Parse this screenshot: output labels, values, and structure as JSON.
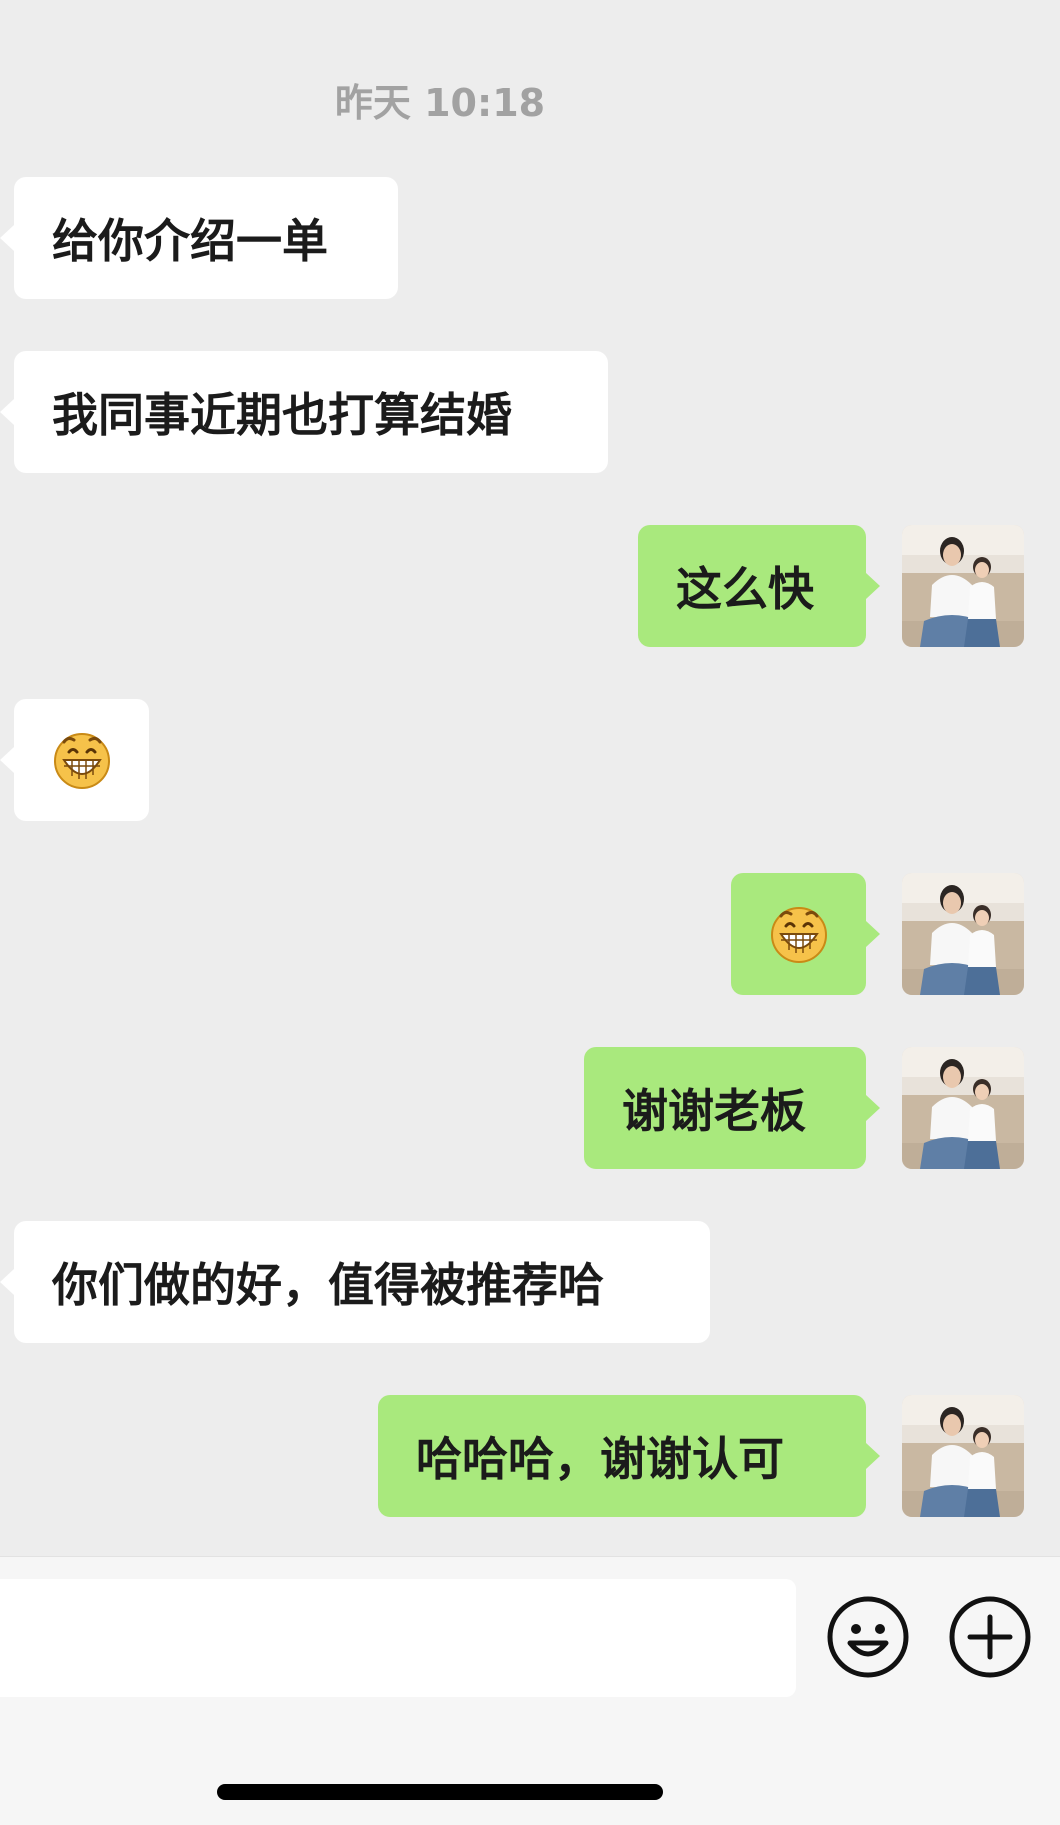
{
  "chat": {
    "timestamp": "昨天 10:18",
    "messages": [
      {
        "side": "in",
        "text": "给你介绍一单"
      },
      {
        "side": "in",
        "text": "我同事近期也打算结婚"
      },
      {
        "side": "out",
        "text": "这么快"
      },
      {
        "side": "in",
        "emoji": "grinning-face-emoji"
      },
      {
        "side": "out",
        "emoji": "grinning-face-emoji"
      },
      {
        "side": "out",
        "text": "谢谢老板"
      },
      {
        "side": "in",
        "text": "你们做的好，值得被推荐哈"
      },
      {
        "side": "out",
        "text": "哈哈哈，谢谢认可"
      }
    ]
  },
  "input_bar": {
    "input_value": "",
    "icons": [
      "smiley-face-icon",
      "plus-circle-icon"
    ]
  },
  "colors": {
    "background": "#ededed",
    "incoming_bubble": "#ffffff",
    "outgoing_bubble": "#a9e97d"
  }
}
